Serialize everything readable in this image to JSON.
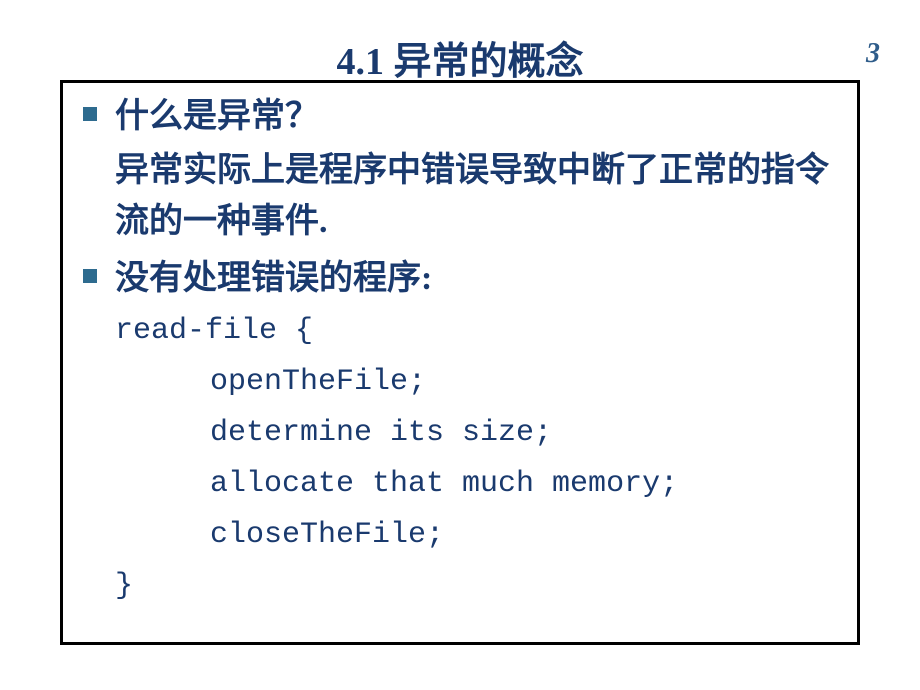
{
  "slide": {
    "title": "4.1 异常的概念",
    "pageNumber": "3",
    "bullet1": {
      "heading": "什么是异常？",
      "body": "异常实际上是程序中错误导致中断了正常的指令流的一种事件."
    },
    "bullet2": {
      "heading": "没有处理错误的程序:",
      "code": {
        "line1": "read-file {",
        "line2": "openTheFile;",
        "line3": "determine its size;",
        "line4": "allocate that much memory;",
        "line5": "closeTheFile;",
        "line6": "}"
      }
    }
  }
}
